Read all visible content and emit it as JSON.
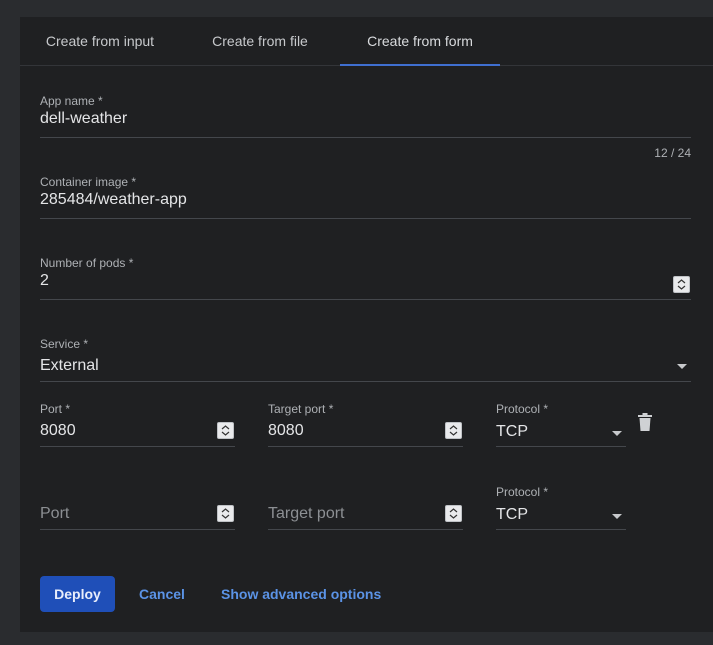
{
  "tabs": [
    {
      "label": "Create from input"
    },
    {
      "label": "Create from file"
    },
    {
      "label": "Create from form",
      "active": true
    }
  ],
  "form": {
    "app_name": {
      "label": "App name *",
      "value": "dell-weather",
      "counter": "12 / 24"
    },
    "container_image": {
      "label": "Container image *",
      "value": "285484/weather-app"
    },
    "pods": {
      "label": "Number of pods *",
      "value": "2"
    },
    "service": {
      "label": "Service *",
      "value": "External"
    },
    "port_rows": [
      {
        "port_label": "Port *",
        "port_value": "8080",
        "target_label": "Target port *",
        "target_value": "8080",
        "protocol_label": "Protocol *",
        "protocol_value": "TCP"
      },
      {
        "port_placeholder": "Port",
        "target_placeholder": "Target port",
        "protocol_label": "Protocol *",
        "protocol_value": "TCP"
      }
    ]
  },
  "actions": {
    "deploy": "Deploy",
    "cancel": "Cancel",
    "advanced": "Show advanced options"
  },
  "colors": {
    "accent": "#1f4fb8",
    "link": "#5b93e6",
    "tab_indicator": "#3f6fd1",
    "background": "#1f2022"
  }
}
